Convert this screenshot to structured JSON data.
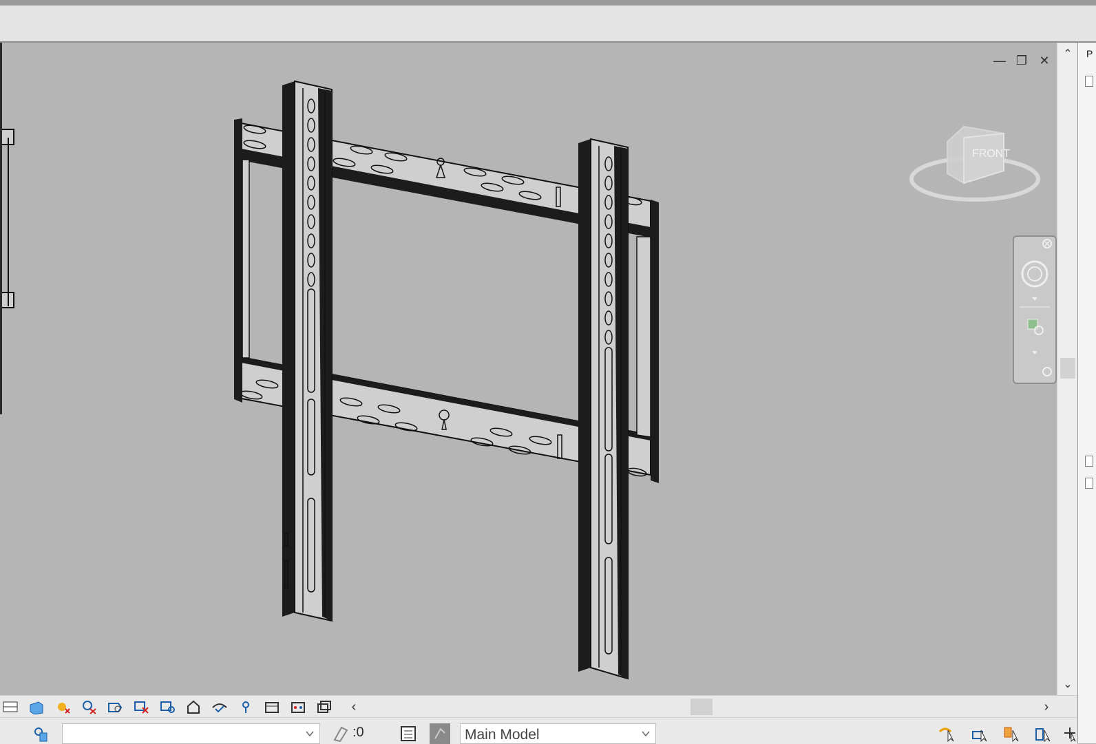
{
  "window": {
    "controls": {
      "minimize_icon": "minimize-icon",
      "restore_icon": "restore-icon",
      "close_icon": "close-icon"
    }
  },
  "viewcube": {
    "face_label": "FRONT"
  },
  "right_panel": {
    "label": "P"
  },
  "view_control_bar": {
    "icons": [
      "scale-icon",
      "detail-level-icon",
      "visual-style-icon",
      "sun-path-icon",
      "shadows-icon",
      "crop-view-icon",
      "show-crop-icon",
      "temporary-hide-icon",
      "reveal-hidden-icon",
      "lock-3d-view-icon",
      "worksharing-display-icon",
      "analytical-model-icon",
      "highlight-displacement-icon"
    ]
  },
  "status_bar": {
    "selection_count": ":0",
    "model_combo_value": "Main Model",
    "workset_combo_value": ""
  },
  "colors": {
    "viewport_bg": "#b5b5b5",
    "bracket_dark": "#1c1c1c",
    "bracket_light": "#cfcfcf",
    "ribbon_bg": "#e4e4e4"
  }
}
